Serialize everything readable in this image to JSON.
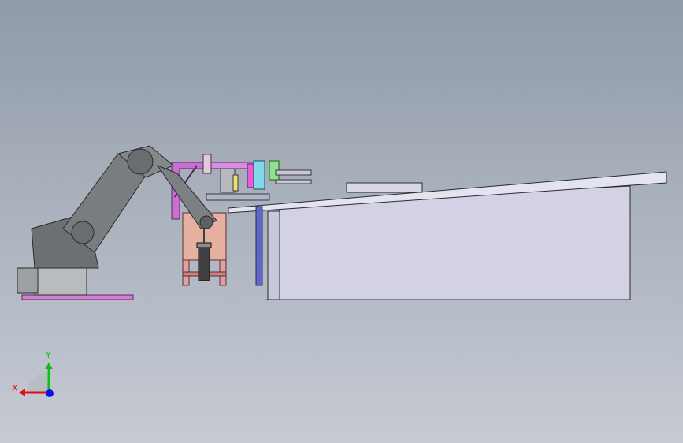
{
  "viewport": {
    "background_top": "#8f9aa8",
    "background_bottom": "#c6cad3"
  },
  "scene": {
    "robot_color": "#7a7d80",
    "base_plate_color": "#d27fd0",
    "fixture_color": "#e0a89a",
    "frame_color": "#c86fd0",
    "post_color": "#5e66c8",
    "table_color": "#d2d2e4"
  },
  "triad": {
    "x_label": "X",
    "y_label": "Y",
    "x_color": "#e01010",
    "y_color": "#10c010",
    "z_color": "#1010e0"
  }
}
